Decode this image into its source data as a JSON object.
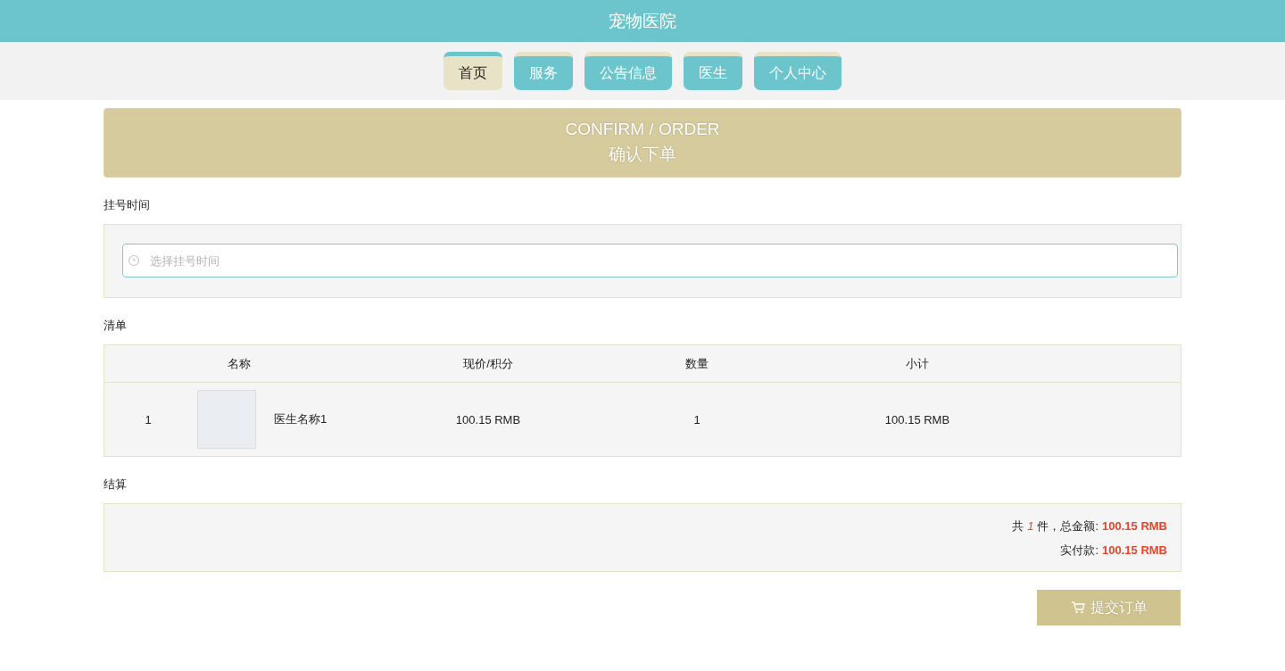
{
  "header": {
    "title": "宠物医院"
  },
  "nav": [
    {
      "label": "首页",
      "selected": true
    },
    {
      "label": "服务",
      "selected": false
    },
    {
      "label": "公告信息",
      "selected": false
    },
    {
      "label": "医生",
      "selected": false
    },
    {
      "label": "个人中心",
      "selected": false
    }
  ],
  "banner": {
    "title": "CONFIRM / ORDER",
    "subtitle": "确认下单"
  },
  "time_section": {
    "label": "挂号时间",
    "placeholder": "选择挂号时间"
  },
  "list_section": {
    "label": "清单",
    "columns": [
      "名称",
      "现价/积分",
      "数量",
      "小计"
    ],
    "rows": [
      {
        "index": "1",
        "name": "医生名称1",
        "price": "100.15 RMB",
        "quantity": "1",
        "subtotal": "100.15 RMB"
      }
    ]
  },
  "settle_section": {
    "label": "结算",
    "count_prefix": "共",
    "count": "1",
    "count_suffix": "件，总金额:",
    "total": "100.15 RMB",
    "paid_label": "实付款:",
    "paid": "100.15 RMB"
  },
  "submit_button": {
    "label": "提交订单"
  }
}
